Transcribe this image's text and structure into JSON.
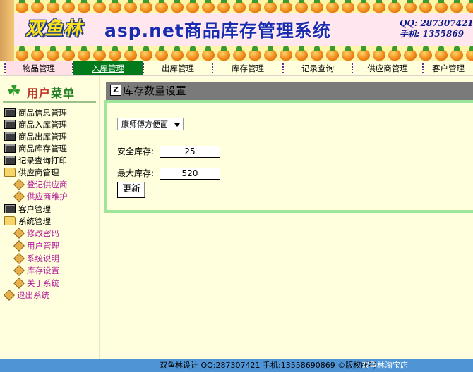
{
  "banner": {
    "logo_text": "双鱼林",
    "system_title": "asp.net商品库存管理系统",
    "contact_qq": "QQ: 287307421",
    "contact_phone": "手机: 1355869"
  },
  "nav": {
    "items": [
      {
        "label": "物品管理"
      },
      {
        "label": "入库管理",
        "active": true
      },
      {
        "label": "出库管理"
      },
      {
        "label": "库存管理"
      },
      {
        "label": "记录查询"
      },
      {
        "label": "供应商管理"
      },
      {
        "label": "客户管理"
      }
    ]
  },
  "sidebar": {
    "title_left": "用户",
    "title_right": "菜单",
    "items": [
      {
        "label": "商品信息管理",
        "icon": "computer-icon"
      },
      {
        "label": "商品入库管理",
        "icon": "computer-icon"
      },
      {
        "label": "商品出库管理",
        "icon": "computer-icon"
      },
      {
        "label": "商品库存管理",
        "icon": "computer-icon"
      },
      {
        "label": "记录查询打印",
        "icon": "computer-icon"
      },
      {
        "label": "供应商管理",
        "icon": "folder-icon"
      },
      {
        "label": "登记供应商",
        "icon": "box-icon"
      },
      {
        "label": "供应商维护",
        "icon": "box-icon"
      },
      {
        "label": "客户管理",
        "icon": "computer-icon"
      },
      {
        "label": "系统管理",
        "icon": "folder-icon"
      },
      {
        "label": "修改密码",
        "icon": "box-icon"
      },
      {
        "label": "用户管理",
        "icon": "box-icon"
      },
      {
        "label": "系统说明",
        "icon": "box-icon"
      },
      {
        "label": "库存设置",
        "icon": "box-icon"
      },
      {
        "label": "关于系统",
        "icon": "box-icon"
      },
      {
        "label": "退出系统",
        "icon": "box-icon"
      }
    ]
  },
  "main": {
    "panel_title": "库存数量设置",
    "product_select": {
      "selected": "康师傅方便面"
    },
    "safety_stock": {
      "label": "安全库存:",
      "value": "25"
    },
    "max_stock": {
      "label": "最大库存:",
      "value": "520"
    },
    "update_button": "更新"
  },
  "footer": {
    "text": "双鱼林设计 QQ:287307421 手机:13558690869 ©版权所有",
    "link": "双鱼林淘宝店"
  },
  "colors": {
    "nav_active": "#007a1a",
    "panel_border": "#9ce59a",
    "footer_bg": "#4f95d6",
    "content_bg": "#ffffdd",
    "submenu_text": "#b0189a"
  }
}
